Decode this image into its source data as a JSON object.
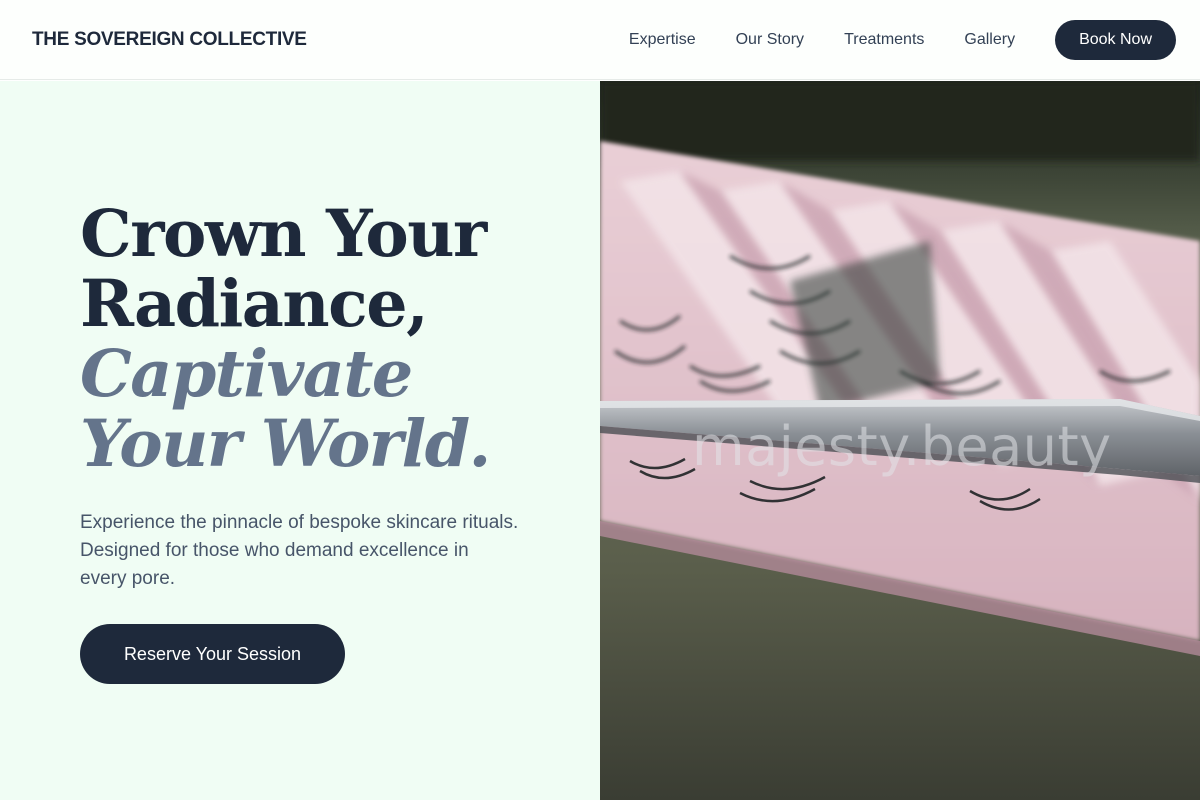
{
  "header": {
    "brand": "THE SOVEREIGN COLLECTIVE",
    "nav": [
      {
        "label": "Expertise"
      },
      {
        "label": "Our Story"
      },
      {
        "label": "Treatments"
      },
      {
        "label": "Gallery"
      }
    ],
    "book_button": "Book Now"
  },
  "hero": {
    "headline_line1": "Crown Your",
    "headline_line2": "Radiance,",
    "headline_line3": "Captivate",
    "headline_line4": "Your World.",
    "subtitle": "Experience the pinnacle of bespoke skincare rituals. Designed for those who demand excellence in every pore.",
    "cta": "Reserve Your Session",
    "image_watermark": "majesty.beauty",
    "image_subject": "eyelash-extension-tray-with-tweezers"
  },
  "colors": {
    "primary": "#1e293b",
    "accent_text": "#64748b",
    "hero_background": "#f0fdf4",
    "body_text": "#475569"
  }
}
